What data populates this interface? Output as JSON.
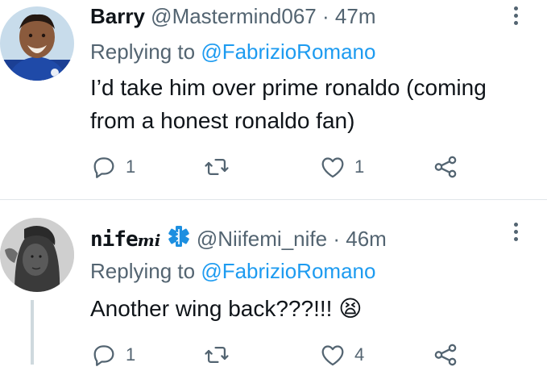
{
  "tweets": [
    {
      "name": "Barry",
      "handle": "@Mastermind067",
      "separator": "·",
      "time": "47m",
      "replying_prefix": "Replying to ",
      "replying_to": "@FabrizioRomano",
      "text": "I’d take him over prime ronaldo (coming from a honest ronaldo fan)",
      "replies": "1",
      "retweets": "",
      "likes": "1"
    },
    {
      "name": "nifemi",
      "name_styled_prefix": "nife",
      "name_styled_suffix": "mi",
      "handle": "@Niifemi_nife",
      "separator": "·",
      "time": "46m",
      "replying_prefix": "Replying to ",
      "replying_to": "@FabrizioRomano",
      "text": "Another wing back???!!! 😫",
      "replies": "1",
      "retweets": "",
      "likes": "4"
    }
  ],
  "colors": {
    "text": "#0f1419",
    "muted": "#536471",
    "link": "#1d9bf0",
    "medical": "#1d8fe0"
  },
  "icons": [
    "reply-icon",
    "retweet-icon",
    "like-icon",
    "share-icon",
    "more-icon",
    "medical-symbol-icon"
  ]
}
